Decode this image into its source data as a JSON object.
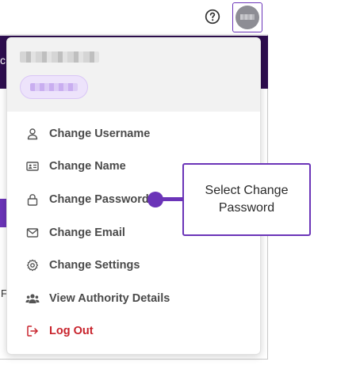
{
  "background": {
    "fragment_c": "c",
    "fragment_f": "F"
  },
  "header": {
    "help_icon": "question-circle-icon",
    "avatar_icon": "user-avatar"
  },
  "menu": {
    "items": [
      {
        "label": "Change Username",
        "icon": "user-icon"
      },
      {
        "label": "Change Name",
        "icon": "id-card-icon"
      },
      {
        "label": "Change Password",
        "icon": "lock-icon"
      },
      {
        "label": "Change Email",
        "icon": "envelope-icon"
      },
      {
        "label": "Change Settings",
        "icon": "gear-icon"
      },
      {
        "label": "View Authority Details",
        "icon": "users-icon"
      },
      {
        "label": "Log Out",
        "icon": "logout-icon"
      }
    ]
  },
  "callout": {
    "text": "Select Change Password"
  },
  "colors": {
    "accent": "#6b34b8",
    "band": "#2e0e4f",
    "logout": "#c8232c",
    "menu_text": "#4a4a4a"
  }
}
